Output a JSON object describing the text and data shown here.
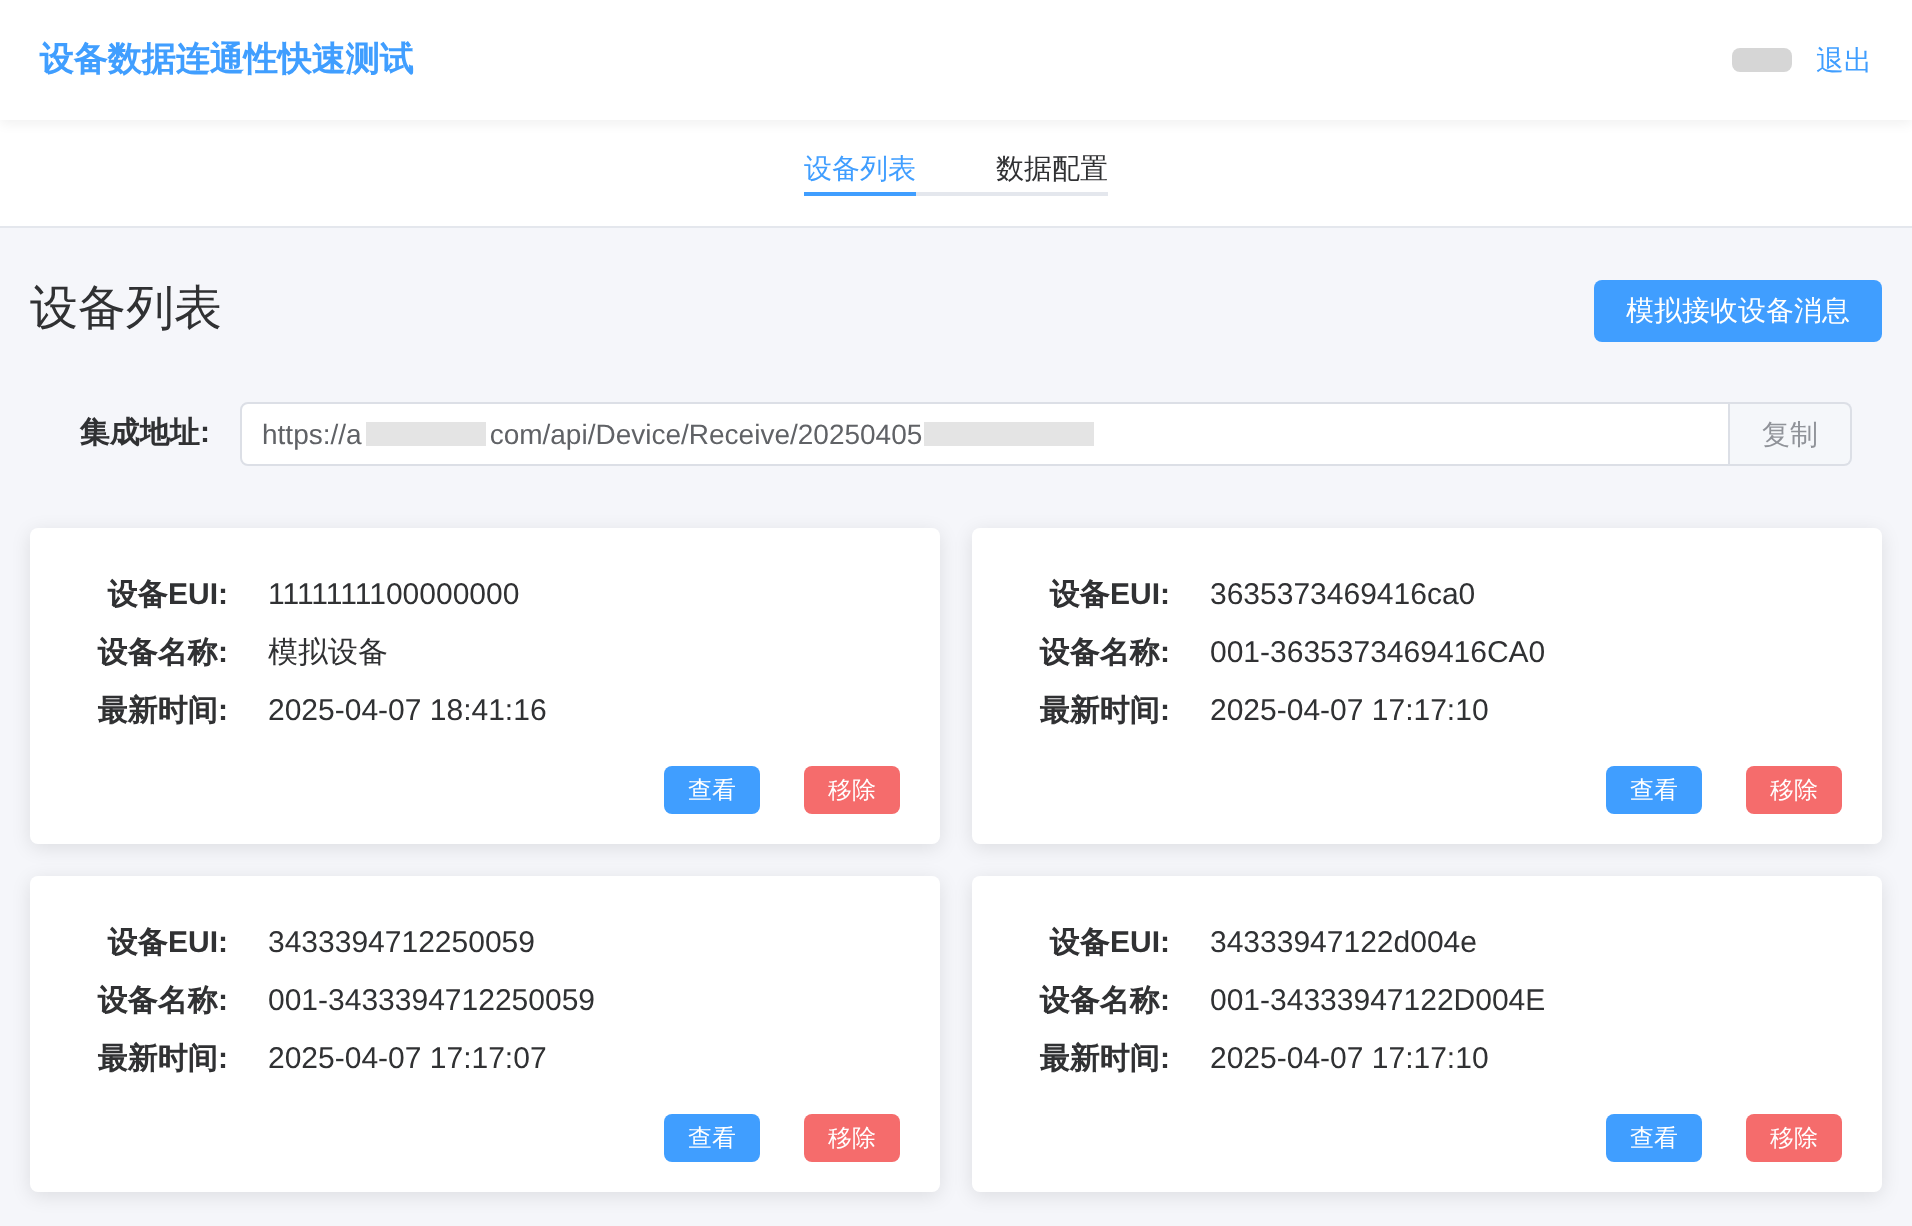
{
  "header": {
    "title": "设备数据连通性快速测试",
    "logout": "退出"
  },
  "tabs": [
    {
      "label": "设备列表",
      "selected": true
    },
    {
      "label": "数据配置",
      "selected": false
    }
  ],
  "page_title": "设备列表",
  "simulate_button": "模拟接收设备消息",
  "integration": {
    "label": "集成地址:",
    "url_start": "https://a",
    "url_middle": "com/api/Device/Receive/20250405",
    "copy_button": "复制"
  },
  "devices": [
    {
      "fields": [
        {
          "label": "设备EUI:",
          "value": "1111111100000000"
        },
        {
          "label": "设备名称:",
          "value": "模拟设备"
        },
        {
          "label": "最新时间:",
          "value": "2025-04-07 18:41:16"
        }
      ],
      "buttons": [
        "查看",
        "移除"
      ]
    },
    {
      "fields": [
        {
          "label": "设备EUI:",
          "value": "3635373469416ca0"
        },
        {
          "label": "设备名称:",
          "value": "001-3635373469416CA0"
        },
        {
          "label": "最新时间:",
          "value": "2025-04-07 17:17:10"
        }
      ],
      "buttons": [
        "查看",
        "移除"
      ]
    },
    {
      "fields": [
        {
          "label": "设备EUI:",
          "value": "3433394712250059"
        },
        {
          "label": "设备名称:",
          "value": "001-3433394712250059"
        },
        {
          "label": "最新时间:",
          "value": "2025-04-07 17:17:07"
        }
      ],
      "buttons": [
        "查看",
        "移除"
      ]
    },
    {
      "fields": [
        {
          "label": "设备EUI:",
          "value": "34333947122d004e"
        },
        {
          "label": "设备名称:",
          "value": "001-34333947122D004E"
        },
        {
          "label": "最新时间:",
          "value": "2025-04-07 17:17:10"
        }
      ],
      "buttons": [
        "查看",
        "移除"
      ]
    }
  ]
}
